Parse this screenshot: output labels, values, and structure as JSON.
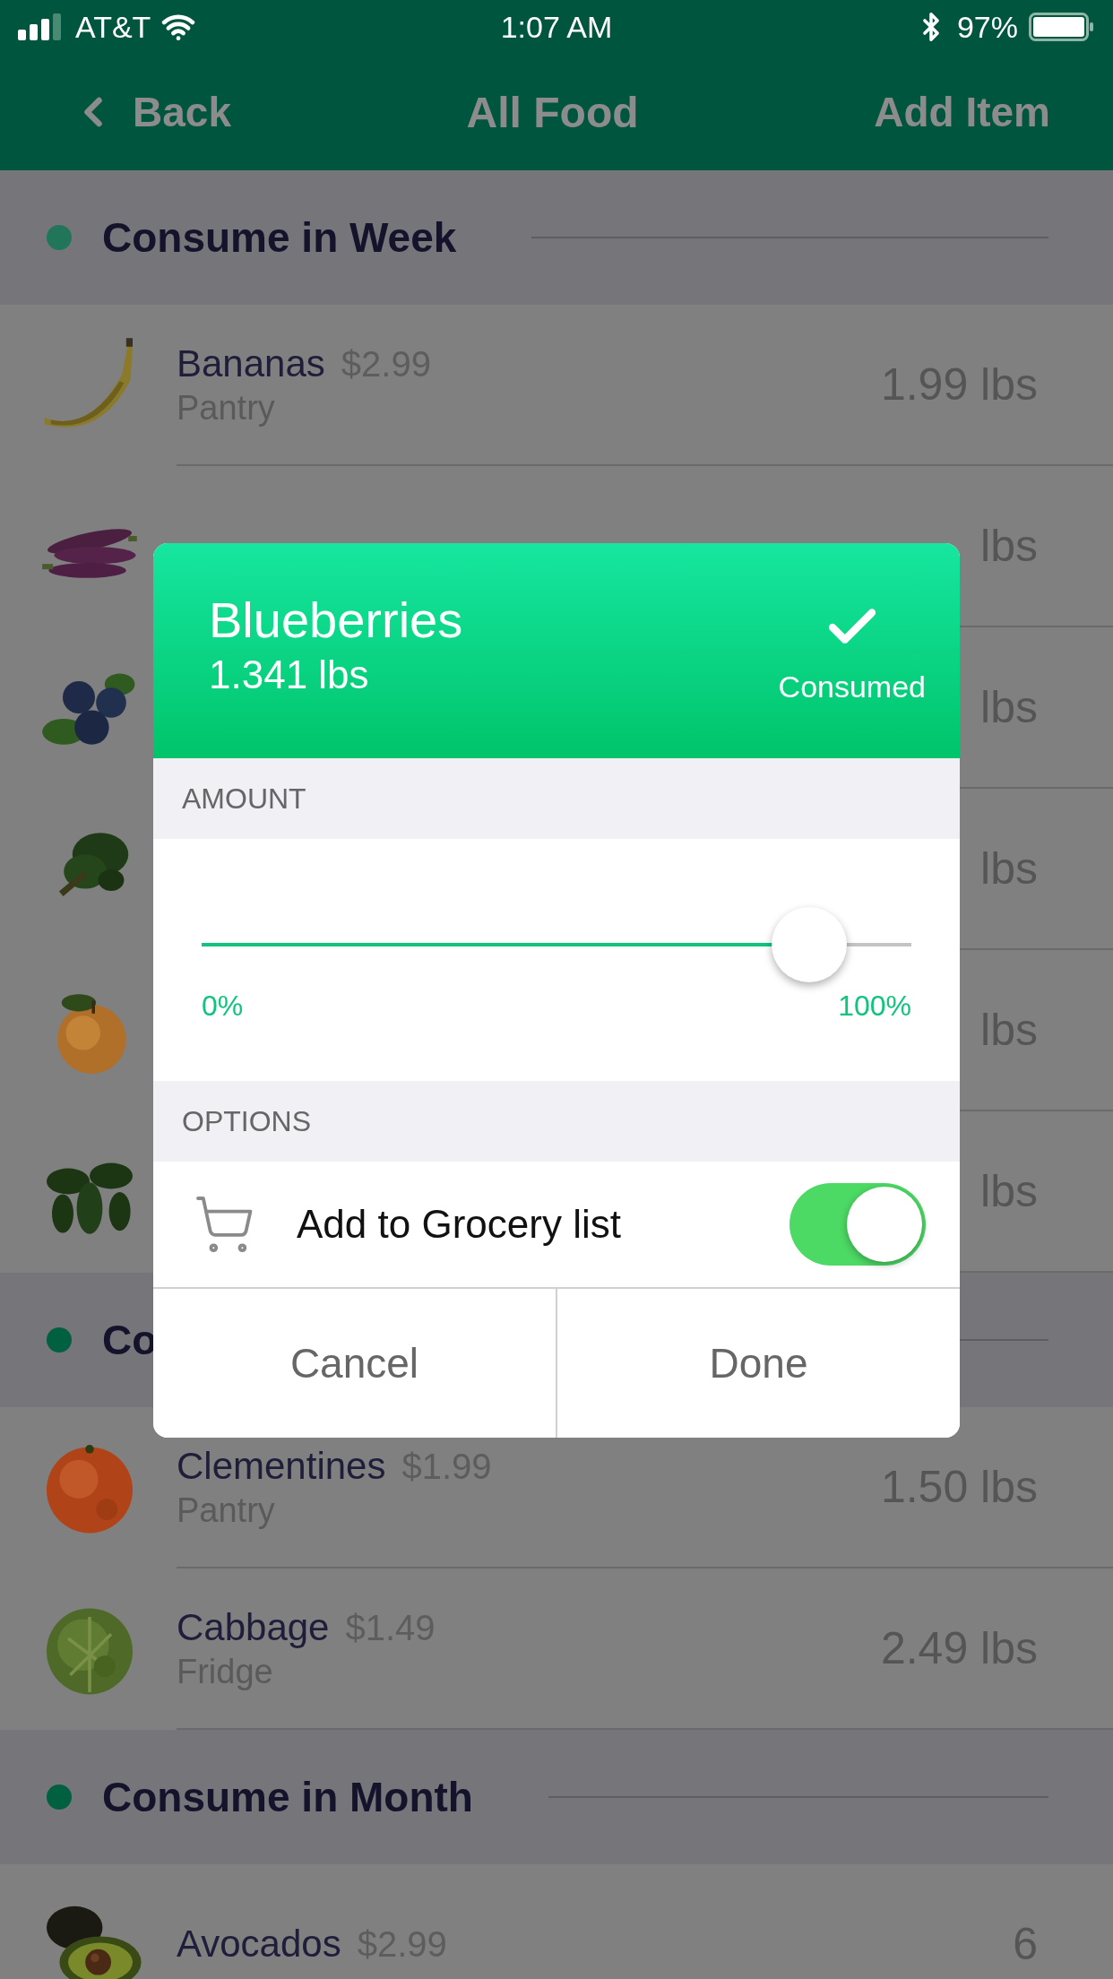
{
  "status_bar": {
    "carrier": "AT&T",
    "time": "1:07 AM",
    "battery": "97%"
  },
  "nav": {
    "back": "Back",
    "title": "All Food",
    "action": "Add Item"
  },
  "sections": [
    {
      "title": "Consume in Week",
      "color": "#21765a",
      "items": [
        {
          "name": "Bananas",
          "price": "$2.99",
          "location": "Pantry",
          "amount": "1.99 lbs"
        },
        {
          "amount": "lbs"
        },
        {
          "amount": "lbs"
        },
        {
          "amount": "lbs"
        },
        {
          "amount": "lbs"
        },
        {
          "amount": "lbs"
        }
      ]
    },
    {
      "title": "Co",
      "color": "#00603f",
      "items": [
        {
          "name": "Clementines",
          "price": "$1.99",
          "location": "Pantry",
          "amount": "1.50 lbs"
        },
        {
          "name": "Cabbage",
          "price": "$1.49",
          "location": "Fridge",
          "amount": "2.49 lbs"
        }
      ]
    },
    {
      "title": "Consume in Month",
      "color": "#00603f",
      "items": [
        {
          "name": "Avocados",
          "price": "$2.99",
          "amount": "6"
        }
      ]
    }
  ],
  "modal": {
    "title": "Blueberries",
    "subtitle": "1.341 lbs",
    "consumed": "Consumed",
    "amount_label": "AMOUNT",
    "slider": {
      "level": 0.856,
      "min_label": "0%",
      "max_label": "100%"
    },
    "options_label": "OPTIONS",
    "options": [
      {
        "label": "Add to Grocery list",
        "on": true
      }
    ],
    "buttons": [
      "Cancel",
      "Done"
    ]
  }
}
